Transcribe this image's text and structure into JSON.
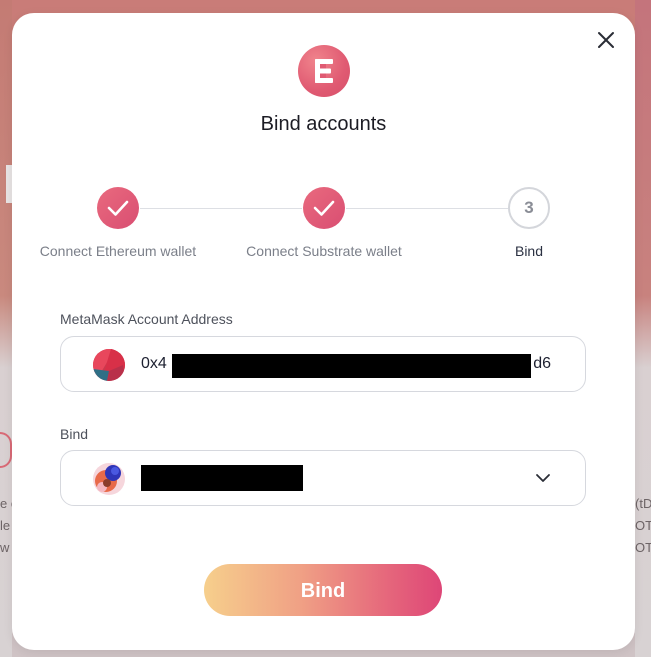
{
  "background": {
    "left_texts": [
      "e c",
      "le",
      "w"
    ],
    "right_texts": [
      "(tD",
      "OT",
      "OT"
    ]
  },
  "modal": {
    "title": "Bind accounts",
    "logo_icon": "e-logo-icon",
    "close_icon": "close-icon"
  },
  "steps": [
    {
      "label": "Connect Ethereum wallet",
      "state": "done"
    },
    {
      "label": "Connect Substrate wallet",
      "state": "done"
    },
    {
      "label": "Bind",
      "number": "3",
      "state": "current"
    }
  ],
  "metamask": {
    "label": "MetaMask Account Address",
    "address_prefix": "0x4",
    "address_suffix": "d6"
  },
  "bind_select": {
    "label": "Bind"
  },
  "actions": {
    "bind_button": "Bind"
  },
  "colors": {
    "accent": "#e05a72",
    "button_gradient_start": "#f6cf8c",
    "button_gradient_end": "#de4677"
  }
}
